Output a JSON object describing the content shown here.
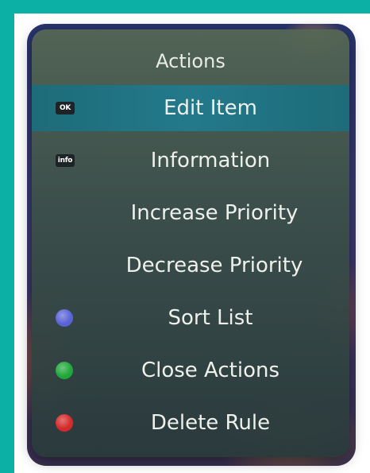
{
  "menu": {
    "title": "Actions",
    "items": [
      {
        "label": "Edit Item",
        "key_type": "badge",
        "key_text": "OK",
        "selected": true
      },
      {
        "label": "Information",
        "key_type": "badge",
        "key_text": "info",
        "selected": false
      },
      {
        "label": "Increase Priority",
        "key_type": "none",
        "selected": false
      },
      {
        "label": "Decrease Priority",
        "key_type": "none",
        "selected": false
      },
      {
        "label": "Sort List",
        "key_type": "dot",
        "key_color": "#5a63d6",
        "selected": false
      },
      {
        "label": "Close Actions",
        "key_type": "dot",
        "key_color": "#1fa83a",
        "selected": false
      },
      {
        "label": "Delete Rule",
        "key_type": "dot",
        "key_color": "#d42a2a",
        "selected": false
      }
    ]
  },
  "colors": {
    "accent_border": "#0db0a4",
    "selected_row": "#23798a"
  }
}
